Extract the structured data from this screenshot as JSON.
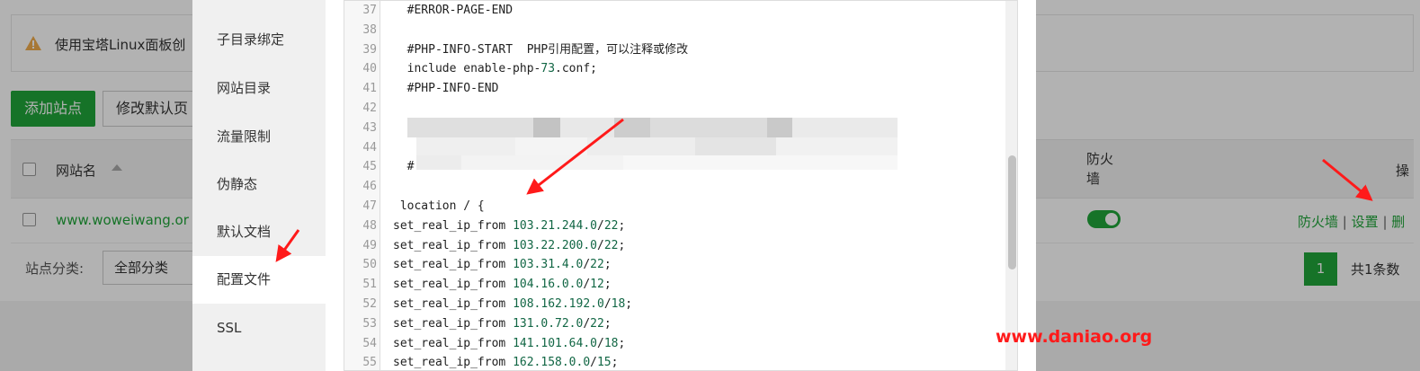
{
  "background": {
    "alert_text": "使用宝塔Linux面板创",
    "add_site_label": "添加站点",
    "modify_default_label": "修改默认页",
    "table": {
      "col_site_name": "网站名",
      "col_firewall": "防火墙",
      "col_ops": "操",
      "row": {
        "site": "www.woweiwang.or",
        "firewall_on": true,
        "action_firewall": "防火墙",
        "action_settings": "设置",
        "action_delete": "删",
        "separator": "|"
      }
    },
    "category_label": "站点分类:",
    "category_value": "全部分类",
    "pager_current": "1",
    "pager_total": "共1条数"
  },
  "modal": {
    "menu": [
      {
        "label": "子目录绑定"
      },
      {
        "label": "网站目录"
      },
      {
        "label": "流量限制"
      },
      {
        "label": "伪静态"
      },
      {
        "label": "默认文档"
      },
      {
        "label": "配置文件",
        "active": true
      },
      {
        "label": "SSL"
      }
    ],
    "editor_lines": [
      {
        "n": "37",
        "text": "  #ERROR-PAGE-END"
      },
      {
        "n": "38",
        "text": ""
      },
      {
        "n": "39",
        "text": "  #PHP-INFO-START  PHP引用配置，可以注释或修改"
      },
      {
        "n": "40",
        "text": "  include enable-php-73.conf;"
      },
      {
        "n": "41",
        "text": "  #PHP-INFO-END"
      },
      {
        "n": "42",
        "text": ""
      },
      {
        "n": "43",
        "text": ""
      },
      {
        "n": "44",
        "text": ""
      },
      {
        "n": "45",
        "text": "  #"
      },
      {
        "n": "46",
        "text": ""
      },
      {
        "n": "47",
        "text": " location / {"
      },
      {
        "n": "48",
        "text": "set_real_ip_from 103.21.244.0/22;"
      },
      {
        "n": "49",
        "text": "set_real_ip_from 103.22.200.0/22;"
      },
      {
        "n": "50",
        "text": "set_real_ip_from 103.31.4.0/22;"
      },
      {
        "n": "51",
        "text": "set_real_ip_from 104.16.0.0/12;"
      },
      {
        "n": "52",
        "text": "set_real_ip_from 108.162.192.0/18;"
      },
      {
        "n": "53",
        "text": "set_real_ip_from 131.0.72.0/22;"
      },
      {
        "n": "54",
        "text": "set_real_ip_from 141.101.64.0/18;"
      },
      {
        "n": "55",
        "text": "set_real_ip_from 162.158.0.0/15;"
      }
    ]
  },
  "watermark": "www.daniao.org",
  "colors": {
    "brand_green": "#20a53a",
    "arrow_red": "#ff1a1a",
    "code_number": "#116644"
  }
}
